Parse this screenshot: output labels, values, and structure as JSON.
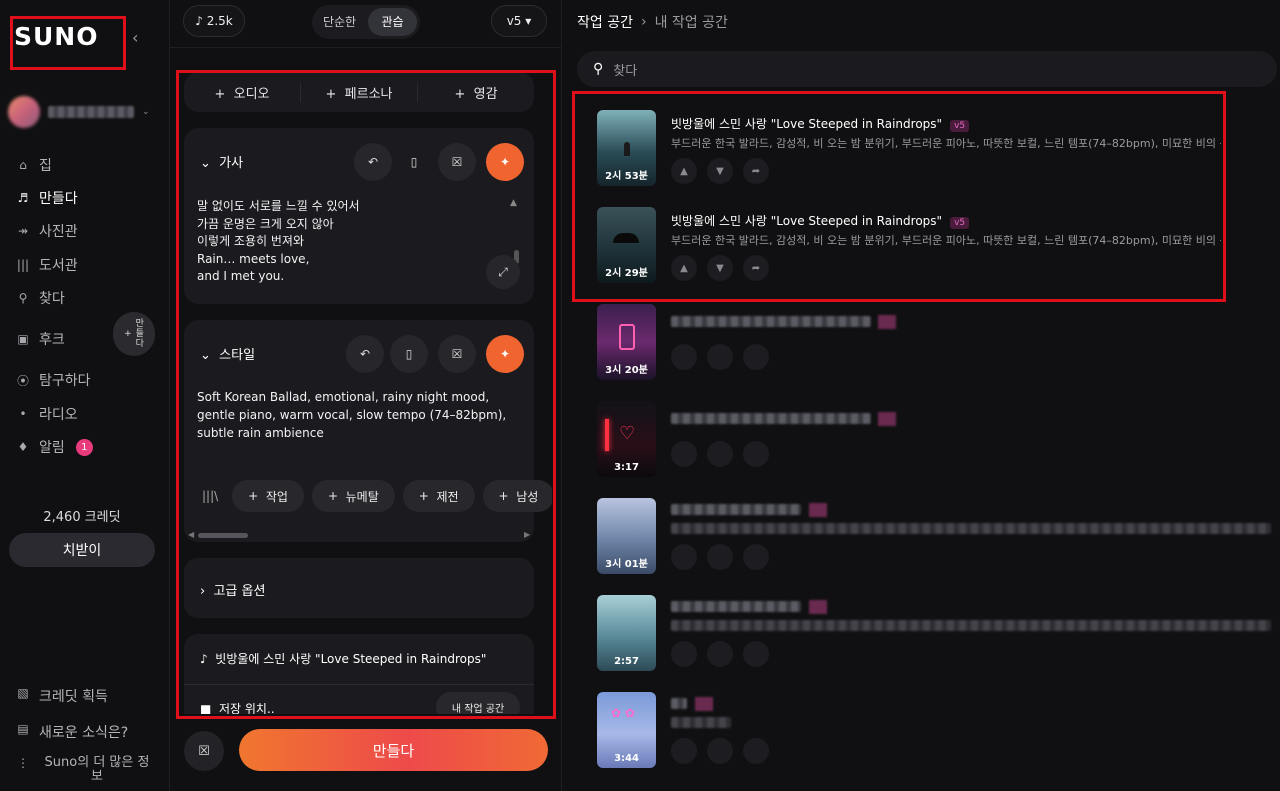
{
  "sidebar": {
    "logo": "SUNO",
    "nav": [
      {
        "label": "집",
        "icon": "home-icon"
      },
      {
        "label": "만들다",
        "icon": "music-note-icon"
      },
      {
        "label": "사진관",
        "icon": "studio-icon"
      },
      {
        "label": "도서관",
        "icon": "library-icon"
      },
      {
        "label": "찾다",
        "icon": "search-icon"
      },
      {
        "label": "후크",
        "icon": "hook-icon"
      },
      {
        "label": "탐구하다",
        "icon": "compass-icon"
      },
      {
        "label": "라디오",
        "icon": "radio-icon"
      },
      {
        "label": "알림",
        "icon": "bell-icon"
      }
    ],
    "notification_count": "1",
    "make_pill_label": "만\n들\n다",
    "credits": "2,460 크레딧",
    "subscribe": "치받이",
    "bottom": [
      {
        "label": "크레딧 획득",
        "icon": "gift-icon"
      },
      {
        "label": "새로운 소식은?",
        "icon": "news-icon"
      },
      {
        "label": "Suno의 더 많은 정보",
        "icon": "more-icon"
      }
    ]
  },
  "create": {
    "song_count": "2.5k",
    "mode_simple": "단순한",
    "mode_custom": "관습",
    "model": "v5",
    "add_tabs": [
      "오디오",
      "페르소나",
      "영감"
    ],
    "lyrics_label": "가사",
    "lyrics": "말 없이도 서로를 느낄 수 있어서\n가끔 운명은 크게 오지 않아\n이렇게 조용히 번져와\nRain… meets love,\nand I met you.",
    "style_label": "스타일",
    "style_text": "Soft Korean Ballad, emotional, rainy night mood, gentle piano, warm vocal, slow tempo (74–82bpm), subtle rain ambience",
    "style_chips": [
      "작업",
      "뉴메탈",
      "제전",
      "남성"
    ],
    "advanced": "고급 옵션",
    "song_title": "빗방울에 스민 사랑 \"Love Steeped in Raindrops\"",
    "save_label": "저장 위치..",
    "workspace_button": "내 작업 공간",
    "make_button": "만들다"
  },
  "workspace": {
    "breadcrumb_root": "작업 공간",
    "breadcrumb_current": "내 작업 공간",
    "search_placeholder": "찾다",
    "songs": [
      {
        "title": "빗방울에 스민 사랑 \"Love Steeped in Raindrops\"",
        "version": "v5",
        "desc": "부드러운 한국 발라드, 감성적, 비 오는 밤 분위기, 부드러운 피아노, 따뜻한 보컬, 느린 템포(74–82bpm), 미묘한 비의 분위기",
        "duration": "2시 53분"
      },
      {
        "title": "빗방울에 스민 사랑 \"Love Steeped in Raindrops\"",
        "version": "v5",
        "desc": "부드러운 한국 발라드, 감성적, 비 오는 밤 분위기, 부드러운 피아노, 따뜻한 보컬, 느린 템포(74–82bpm), 미묘한 비의 분위기",
        "duration": "2시 29분"
      },
      {
        "duration": "3시 20분"
      },
      {
        "duration": "3:17"
      },
      {
        "duration": "3시 01분"
      },
      {
        "duration": "2:57"
      },
      {
        "duration": "3:44"
      }
    ]
  }
}
